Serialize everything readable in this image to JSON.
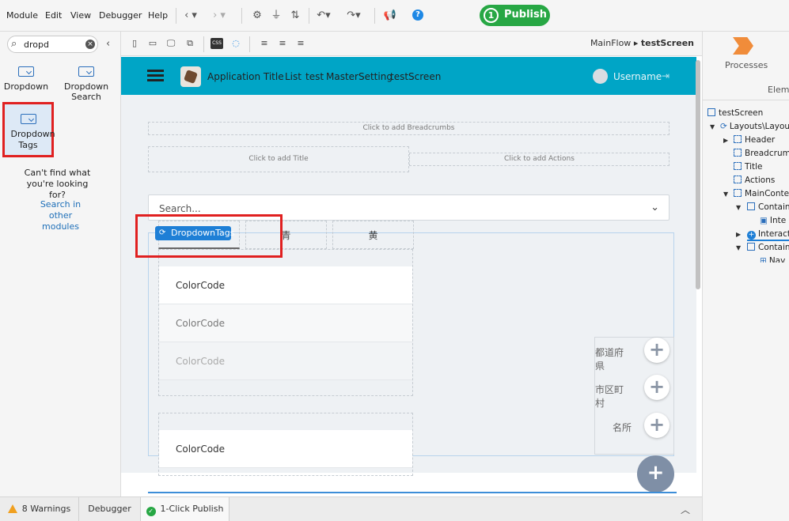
{
  "menu": {
    "items": [
      "Module",
      "Edit",
      "View",
      "Debugger",
      "Help"
    ],
    "publish_count": "1",
    "publish_label": "Publish"
  },
  "left_panel": {
    "search_value": "dropd",
    "widgets": [
      {
        "label": "Dropdown"
      },
      {
        "label": "Dropdown Search"
      },
      {
        "label": "Dropdown Tags"
      }
    ],
    "cant_find": "Can't find what you're looking for?",
    "search_other": "Search in other modules"
  },
  "canvas_toolbar": {
    "flow": "MainFlow",
    "screen": "testScreen"
  },
  "app": {
    "title": "Application Title",
    "nav": [
      "List",
      "test",
      "MasterSetting",
      "testScreen"
    ],
    "username": "Username",
    "breadcrumbs_placeholder": "Click to add Breadcrumbs",
    "title_placeholder": "Click to add Title",
    "actions_placeholder": "Click to add Actions",
    "search_placeholder": "Search...",
    "tabs": [
      "青",
      "黄"
    ],
    "tag_badge": "DropdownTags",
    "list1": [
      "ColorCode",
      "ColorCode",
      "ColorCode"
    ],
    "list2": [
      "ColorCode"
    ],
    "side_labels": [
      "都道府県",
      "市区町村",
      "名所"
    ]
  },
  "right_panel": {
    "processes": "Processes",
    "elements_tab": "Eleme",
    "tree": [
      {
        "label": "testScreen"
      },
      {
        "label": "Layouts\\Layou"
      },
      {
        "label": "Header"
      },
      {
        "label": "Breadcrum"
      },
      {
        "label": "Title"
      },
      {
        "label": "Actions"
      },
      {
        "label": "MainConte"
      },
      {
        "label": "Contain"
      },
      {
        "label": "Inte"
      },
      {
        "label": "Interact"
      },
      {
        "label": "Contain"
      },
      {
        "label": "Nav"
      }
    ]
  },
  "bottom": {
    "warnings": "8 Warnings",
    "debugger": "Debugger",
    "publish": "1-Click Publish"
  },
  "colors": {
    "header": "#00a5c6",
    "publish": "#27a744",
    "highlight": "#e02020",
    "badge": "#1e7fd6"
  }
}
